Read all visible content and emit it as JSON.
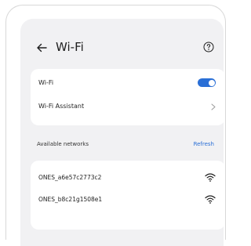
{
  "header": {
    "title": "Wi-Fi",
    "back_icon": "arrow-left-icon",
    "help_icon": "question-circle-icon"
  },
  "settings": {
    "wifi_label": "Wi-Fi",
    "wifi_enabled": true,
    "assistant_label": "Wi-Fi Assistant"
  },
  "available": {
    "section_label": "Available networks",
    "refresh_label": "Refresh",
    "networks": [
      {
        "ssid": "ONES_a6e57c2773c2",
        "icon": "wifi-signal-icon"
      },
      {
        "ssid": "ONES_b8c21g1508e1",
        "icon": "wifi-signal-icon"
      }
    ]
  },
  "colors": {
    "accent": "#2a6fd6",
    "screen_bg": "#f1f1f3",
    "card_bg": "#ffffff",
    "text": "#1f1f1f"
  }
}
